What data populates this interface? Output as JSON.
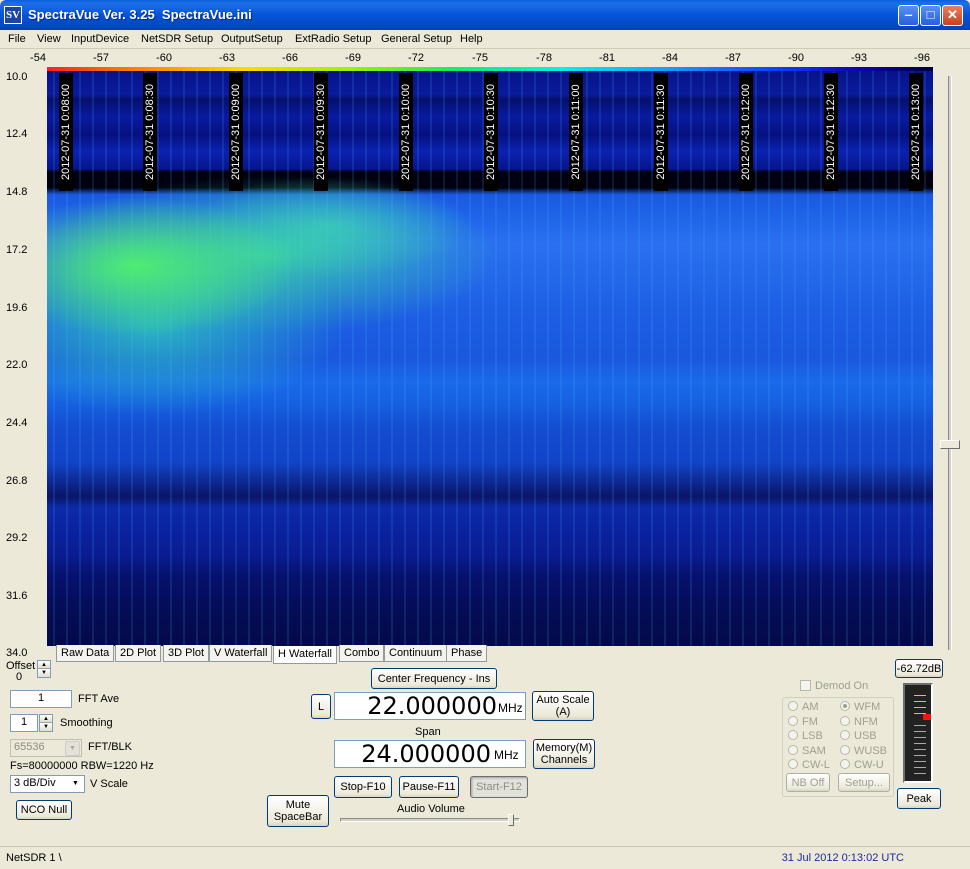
{
  "window": {
    "title": "SpectraVue Ver. 3.25  SpectraVue.ini",
    "icon_text": "SV"
  },
  "menu": [
    "File",
    "View",
    "InputDevice",
    "NetSDR Setup",
    "OutputSetup",
    "ExtRadio Setup",
    "General Setup",
    "Help"
  ],
  "freq_axis": {
    "ticks": [
      "-54",
      "-57",
      "-60",
      "-63",
      "-66",
      "-69",
      "-72",
      "-75",
      "-78",
      "-81",
      "-84",
      "-87",
      "-90",
      "-93",
      "-96"
    ]
  },
  "y_axis": {
    "ticks": [
      "10.0",
      "12.4",
      "14.8",
      "17.2",
      "19.6",
      "22.0",
      "24.4",
      "26.8",
      "29.2",
      "31.6",
      "34.0"
    ]
  },
  "waterfall": {
    "timestamps": [
      "2012-07-31 0:08:00",
      "2012-07-31 0:08:30",
      "2012-07-31 0:09:00",
      "2012-07-31 0:09:30",
      "2012-07-31 0:10:00",
      "2012-07-31 0:10:30",
      "2012-07-31 0:11:00",
      "2012-07-31 0:11:30",
      "2012-07-31 0:12:00",
      "2012-07-31 0:12:30",
      "2012-07-31 0:13:00"
    ]
  },
  "tabs": [
    {
      "label": "Raw Data",
      "active": false
    },
    {
      "label": "2D Plot",
      "active": false
    },
    {
      "label": "3D Plot",
      "active": false
    },
    {
      "label": "V Waterfall",
      "active": false
    },
    {
      "label": "H Waterfall",
      "active": true
    },
    {
      "label": "Combo",
      "active": false
    },
    {
      "label": "Continuum",
      "active": false
    },
    {
      "label": "Phase",
      "active": false
    }
  ],
  "controls": {
    "offset_label": "Offset",
    "offset_value": "0",
    "fft_ave_value": "1",
    "fft_ave_label": "FFT Ave",
    "smoothing_value": "1",
    "smoothing_label": "Smoothing",
    "fft_blk_value": "65536",
    "fft_blk_label": "FFT/BLK",
    "fs_info": "Fs=80000000 RBW=1220 Hz",
    "vscale_value": "3 dB/Div",
    "vscale_label": "V Scale",
    "nco_null": "NCO Null",
    "center_freq_button": "Center Frequency - Ins",
    "l_button": "L",
    "center_freq_value": "22.000000",
    "center_unit": "MHz",
    "auto_scale_line1": "Auto Scale",
    "auto_scale_line2": "(A)",
    "span_label": "Span",
    "span_value": "24.000000",
    "span_unit": "MHz",
    "memory_line1": "Memory(M)",
    "memory_line2": "Channels",
    "stop": "Stop-F10",
    "pause": "Pause-F11",
    "start": "Start-F12",
    "mute_line1": "Mute",
    "mute_line2": "SpaceBar",
    "audio_volume": "Audio Volume",
    "audio_volume_level": 0.95
  },
  "demod": {
    "demod_on": "Demod On",
    "modes": [
      {
        "label": "AM",
        "checked": false
      },
      {
        "label": "WFM",
        "checked": true
      },
      {
        "label": "FM",
        "checked": false
      },
      {
        "label": "NFM",
        "checked": false
      },
      {
        "label": "LSB",
        "checked": false
      },
      {
        "label": "USB",
        "checked": false
      },
      {
        "label": "SAM",
        "checked": false
      },
      {
        "label": "WUSB",
        "checked": false
      },
      {
        "label": "CW-L",
        "checked": false
      },
      {
        "label": "CW-U",
        "checked": false
      }
    ],
    "nb_off": "NB Off",
    "setup": "Setup..."
  },
  "meter": {
    "db_value": "-62.72dB",
    "peak": "Peak"
  },
  "status": {
    "left": "NetSDR 1  \\",
    "right": "31 Jul 2012  0:13:02 UTC"
  }
}
